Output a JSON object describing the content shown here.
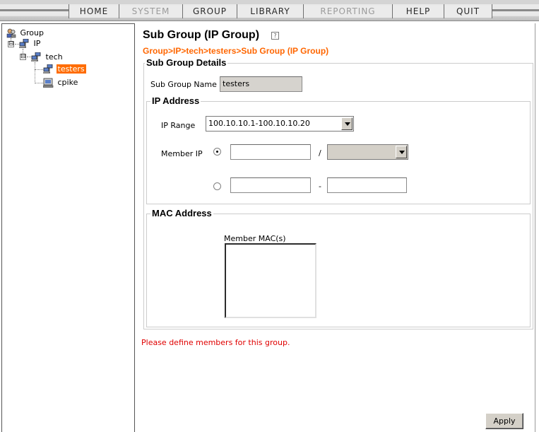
{
  "menu": {
    "items": [
      {
        "label": "HOME",
        "enabled": true
      },
      {
        "label": "SYSTEM",
        "enabled": false
      },
      {
        "label": "GROUP",
        "enabled": true
      },
      {
        "label": "LIBRARY",
        "enabled": true
      },
      {
        "label": "REPORTING",
        "enabled": false
      },
      {
        "label": "HELP",
        "enabled": true
      },
      {
        "label": "QUIT",
        "enabled": true
      }
    ]
  },
  "tree": {
    "root": "Group",
    "ip": "IP",
    "tech": "tech",
    "testers": "testers",
    "cpike": "cpike",
    "expand_symbol": "⊟"
  },
  "page": {
    "title": "Sub Group (IP Group)",
    "help_icon": "?",
    "breadcrumb": "Group>IP>tech>testers>Sub Group (IP Group)"
  },
  "details": {
    "legend": "Sub Group Details",
    "name_label": "Sub Group Name",
    "name_value": "testers"
  },
  "ip": {
    "legend": "IP Address",
    "range_label": "IP Range",
    "range_value": "100.10.10.1-100.10.10.20",
    "member_label": "Member IP",
    "mode": "single",
    "ip_value": "",
    "mask_value": "",
    "slash": "/",
    "range_from": "",
    "range_to": "",
    "dash": "-"
  },
  "mac": {
    "legend": "MAC Address",
    "member_label": "Member MAC(s)"
  },
  "error": "Please define members for this group.",
  "apply_label": "Apply",
  "colors": {
    "accent": "#ff6600",
    "selection": "#ff6c00",
    "error": "#e00000"
  }
}
